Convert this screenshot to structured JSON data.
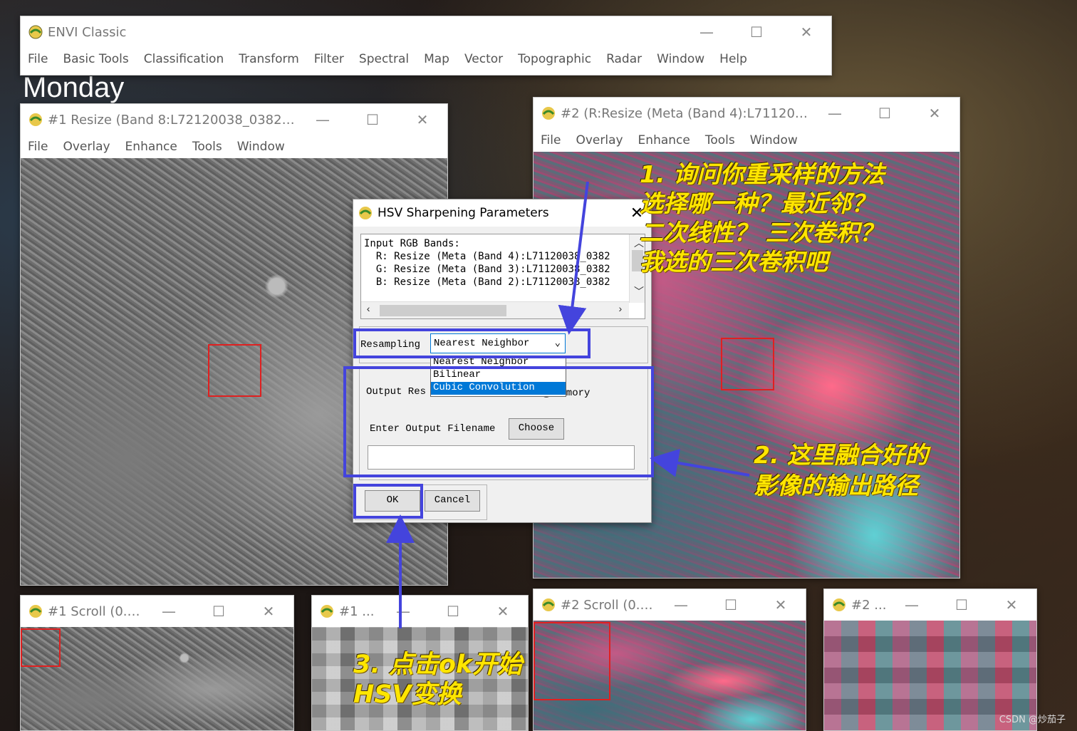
{
  "background": {
    "caption": "Monday",
    "watermark": "CSDN @炒茄子"
  },
  "window_controls": {
    "min": "—",
    "max": "☐",
    "close": "✕"
  },
  "envi_main": {
    "title": "ENVI Classic",
    "menu": [
      "File",
      "Basic Tools",
      "Classification",
      "Transform",
      "Filter",
      "Spectral",
      "Map",
      "Vector",
      "Topographic",
      "Radar",
      "Window",
      "Help"
    ]
  },
  "image_window_1": {
    "title": "#1 Resize (Band 8:L72120038_038200...",
    "menu": [
      "File",
      "Overlay",
      "Enhance",
      "Tools",
      "Window"
    ]
  },
  "image_window_2": {
    "title": "#2 (R:Resize (Meta (Band 4):L7112003...",
    "menu": [
      "File",
      "Overlay",
      "Enhance",
      "Tools",
      "Window"
    ]
  },
  "scroll_1": {
    "title": "#1 Scroll (0.0..."
  },
  "zoom_1": {
    "title": "#1 ..."
  },
  "scroll_2": {
    "title": "#2 Scroll (0.1..."
  },
  "zoom_2": {
    "title": "#2 ..."
  },
  "dialog": {
    "title": "HSV Sharpening Parameters",
    "close": "✕",
    "input_label": "Input RGB Bands:",
    "bands": [
      "  R: Resize (Meta (Band 4):L71120038_0382",
      "  G: Resize (Meta (Band 3):L71120038_0382",
      "  B: Resize (Meta (Band 2):L71120038_0382"
    ],
    "resampling_label": "Resampling",
    "resampling_value": "Nearest Neighbor",
    "resampling_options": [
      "Nearest Neighbor",
      "Bilinear",
      "Cubic Convolution"
    ],
    "resampling_selected": "Cubic Convolution",
    "output_label": "Output Res",
    "memory_label": "Memory",
    "filename_label": "Enter Output Filename",
    "choose_label": "Choose",
    "filename_value": "",
    "ok_label": "OK",
    "cancel_label": "Cancel"
  },
  "annotations": {
    "note1": [
      "1. 询问你重采样的方法",
      "选择哪一种？最近邻？",
      "二次线性？ 三次卷积？",
      "我选的三次卷积吧"
    ],
    "note2": [
      "2. 这里融合好的",
      "影像的输出路径"
    ],
    "note3": [
      "3. 点击ok开始",
      "HSV变换"
    ],
    "highlight_color": "#4444dd",
    "text_color": "#ffe600"
  }
}
